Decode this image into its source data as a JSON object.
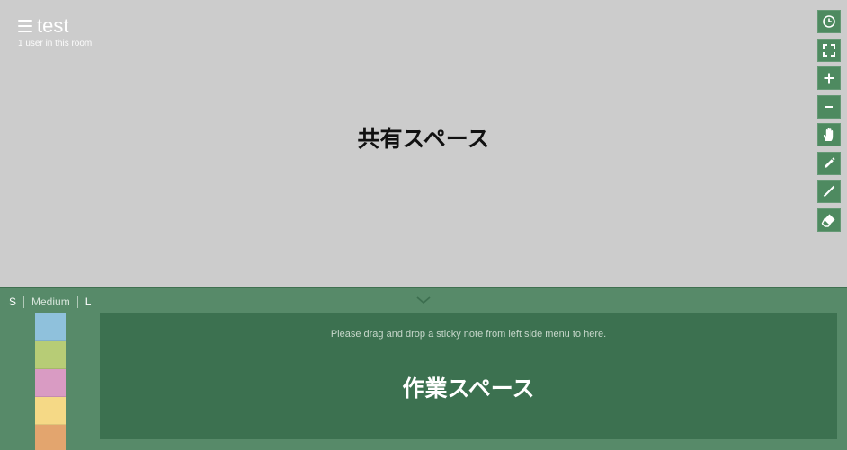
{
  "room": {
    "title": "test",
    "users": "1 user in this room"
  },
  "shared_space": {
    "label": "共有スペース"
  },
  "toolbar": {
    "color": "#4e8a60",
    "tools": [
      {
        "icon": "clock-icon",
        "name": "history"
      },
      {
        "icon": "fullscreen-icon",
        "name": "fullscreen"
      },
      {
        "icon": "plus-icon",
        "name": "zoom-in"
      },
      {
        "icon": "minus-icon",
        "name": "zoom-out"
      },
      {
        "icon": "hand-icon",
        "name": "pan"
      },
      {
        "icon": "pencil-icon",
        "name": "pen"
      },
      {
        "icon": "line-icon",
        "name": "line"
      },
      {
        "icon": "eraser-icon",
        "name": "eraser"
      }
    ]
  },
  "work_panel": {
    "sizes": [
      "S",
      "Medium",
      "L"
    ],
    "drop_hint": "Please drag and drop a sticky note from left side menu to here.",
    "label": "作業スペース",
    "colors": {
      "panel": "#578a69",
      "drop_zone": "#3c7150"
    }
  },
  "palette": {
    "swatches": [
      "#8fc1dc",
      "#b7cc76",
      "#d99bc3",
      "#f5d986",
      "#e3a56e"
    ]
  }
}
